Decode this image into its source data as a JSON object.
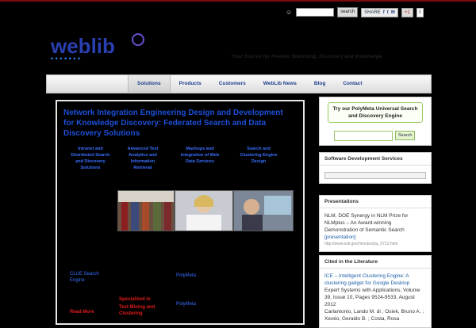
{
  "topbar": {
    "search_button": "search",
    "share_label": "SHARE",
    "gplus_label": "+1",
    "gplus_count": "0"
  },
  "tagline": "Your Source for Premier Searching, Discovery and Knowledge",
  "nav": {
    "items": [
      {
        "label": "Solutions",
        "active": true
      },
      {
        "label": "Products",
        "active": false
      },
      {
        "label": "Customers",
        "active": false
      },
      {
        "label": "WebLib News",
        "active": false
      },
      {
        "label": "Blog",
        "active": false
      },
      {
        "label": "Contact",
        "active": false
      }
    ]
  },
  "main": {
    "headline": "Network Integration Engineering Design and Development for Knowledge Discovery: Federated Search and Data Discovery Solutions",
    "columns": [
      "Intranet and Distributed Search and Discovery Solutions",
      "Advanced Text Analytics and Information Retrieval",
      "Mashups and Integration of Web Data Services",
      "Search and Clustering Engine Design"
    ],
    "links": [
      "CLUE Search Engine",
      "PolyMeta",
      "PolyMeta"
    ],
    "red_notes": [
      "Specialized in",
      "Text Mining and Clustering",
      "Read More"
    ]
  },
  "sidebar": {
    "polymeta": {
      "button": "Try our PolyMeta Universal Search and Discovery Engine",
      "search_button": "Search"
    },
    "software": {
      "title": "Software Development Services"
    },
    "presentations": {
      "title": "Presentations",
      "text": "NLM, DOE Synergy in NLM Prize for NLMplus – An Award-winning Demonstration of Semantic Search",
      "link": "[presentation]",
      "url": "http://www.osti.gov/minutes/pa_0712.html"
    },
    "cited": {
      "title": "Cited in the Literature",
      "link": "ICE – Intelligent Clustering Engine: A clustering gadget for Google Desktop",
      "text": "Expert Systems with Applications, Volume 39, Issue 10, Pages 9524-9533, August 2012",
      "authors": "Carlantonio, Lando M. di ; Osiek, Bruno A. ; Xexéo, Geraldo B. ; Costa, Rosa"
    }
  }
}
